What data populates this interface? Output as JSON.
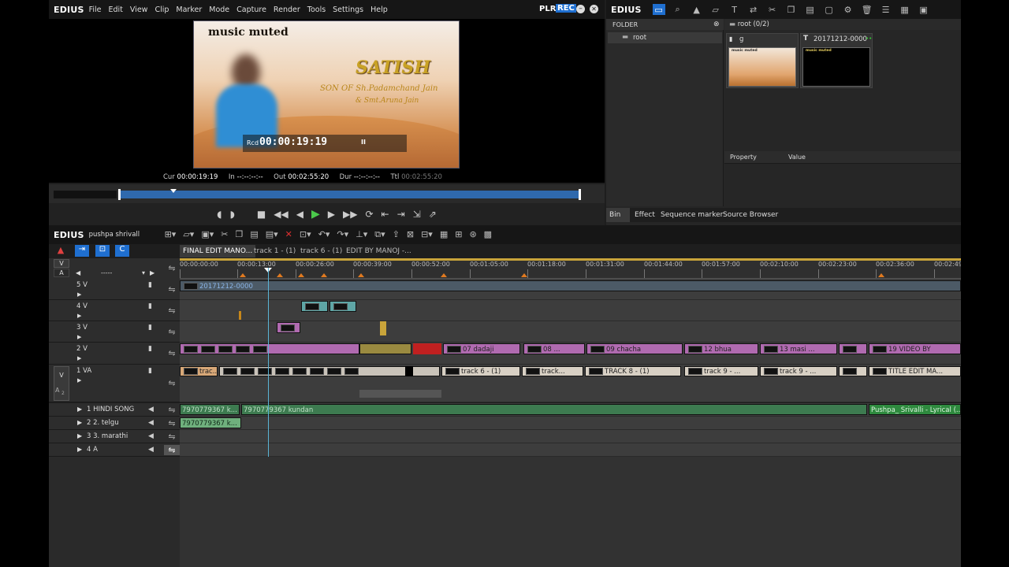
{
  "app": {
    "logo": "EDIUS"
  },
  "menu": [
    "File",
    "Edit",
    "View",
    "Clip",
    "Marker",
    "Mode",
    "Capture",
    "Render",
    "Tools",
    "Settings",
    "Help"
  ],
  "mode": {
    "plr": "PLR",
    "rec": "REC"
  },
  "preview": {
    "overlay_title": "music muted",
    "name": "SATISH",
    "line1": "SON OF Sh.Padamchand Jain",
    "line2": "& Smt.Aruna Jain",
    "rcd_label": "Rcd",
    "rcd_tc": "00:00:19:19",
    "pause": "II",
    "cur_label": "Cur",
    "cur": "00:00:19:19",
    "in_label": "In",
    "in": "--:--:--:--",
    "out_label": "Out",
    "out": "00:02:55:20",
    "dur_label": "Dur",
    "dur": "--:--:--:--",
    "ttl_label": "Ttl",
    "ttl": "00:02:55:20"
  },
  "bin": {
    "folder_header": "FOLDER",
    "root_item": "root",
    "path": "root (0/2)",
    "clip1_name": "g",
    "clip1_thumb_text": "music muted",
    "clip2_name": "20171212-0000",
    "clip2_thumb_text": "music muted",
    "prop_col": "Property",
    "val_col": "Value",
    "tabs": [
      "Bin",
      "Effect",
      "Sequence marker",
      "Source Browser"
    ]
  },
  "timeline": {
    "logo": "EDIUS",
    "project": "pushpa shrivall",
    "seq_tabs": [
      "FINAL EDIT MANO...",
      "track 1 - (1)",
      "track 6 - (1)",
      "EDIT BY MANOJ -..."
    ],
    "ruler": [
      "00:00:00:00",
      "00:00:13:00",
      "00:00:26:00",
      "00:00:39:00",
      "00:00:52:00",
      "00:01:05:00",
      "00:01:18:00",
      "00:01:31:00",
      "00:01:44:00",
      "00:01:57:00",
      "00:02:10:00",
      "00:02:23:00",
      "00:02:36:00",
      "00:02:49"
    ],
    "vbtn": "V",
    "abtn": "A",
    "dash": "-----",
    "tracks": {
      "v5": "5 V",
      "v4": "4 V",
      "v3": "3 V",
      "v2": "2 V",
      "va1": "1 VA",
      "a1": "1 HINDI SONG",
      "a2": "2 2. telgu",
      "a3": "3 3. marathi",
      "a4": "4 A",
      "a_sub": "A",
      "a_sub_n": "2"
    },
    "clips": {
      "v5_clip": "20171212-0000",
      "v2_a": "07 dadaji",
      "v2_b": "08 ...",
      "v2_c": "09 chacha",
      "v2_d": "12 bhua",
      "v2_e": "13 masi ...",
      "v2_f": "19 VIDEO BY",
      "va_a": "trac...",
      "va_b": "track 6 - (1)",
      "va_c": "track...",
      "va_d": "TRACK 8 - (1)",
      "va_e": "track 9 - ...",
      "va_f": "track 9 - ...",
      "va_g": "TITLE EDIT MA...",
      "a1_a": "7970779367 k...",
      "a1_b": "7970779367 kundan",
      "a1_c": "Pushpa_ Srivalli - Lyrical (...",
      "a2_a": "7970779367 k..."
    }
  }
}
